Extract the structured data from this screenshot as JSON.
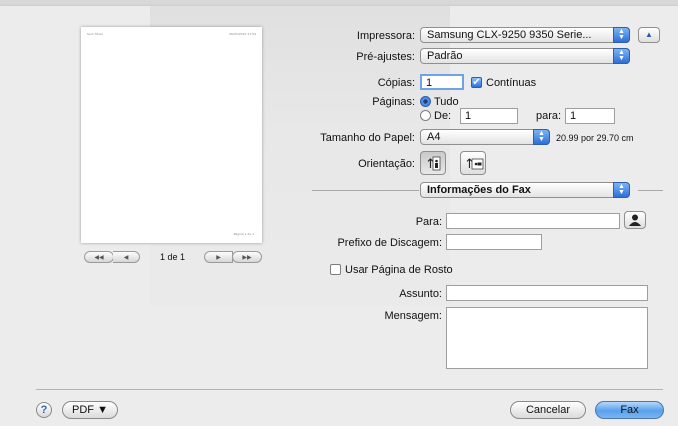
{
  "preview": {
    "header_left": "Sem Título",
    "header_right": "26/05/2010 17:54",
    "footer": "Página 1 de 1",
    "page_indicator": "1 de 1"
  },
  "printer": {
    "label": "Impressora:",
    "value": "Samsung CLX-9250 9350 Serie..."
  },
  "presets": {
    "label": "Pré-ajustes:",
    "value": "Padrão"
  },
  "copies": {
    "label": "Cópias:",
    "value": "1",
    "collated_label": "Contínuas",
    "collated": true
  },
  "pages": {
    "label": "Páginas:",
    "all_label": "Tudo",
    "from_label": "De:",
    "from_value": "1",
    "to_label": "para:",
    "to_value": "1"
  },
  "paper": {
    "label": "Tamanho do Papel:",
    "value": "A4",
    "dimensions": "20.99 por 29.70 cm"
  },
  "orientation": {
    "label": "Orientação:"
  },
  "section": {
    "value": "Informações do Fax"
  },
  "fax": {
    "to_label": "Para:",
    "to_value": "",
    "dial_prefix_label": "Prefixo de Discagem:",
    "dial_prefix_value": "",
    "cover_page_label": "Usar Página de Rosto",
    "subject_label": "Assunto:",
    "subject_value": "",
    "message_label": "Mensagem:",
    "message_value": ""
  },
  "footer": {
    "help_label": "?",
    "pdf_label": "PDF ▼",
    "cancel_label": "Cancelar",
    "fax_label": "Fax"
  },
  "colors": {
    "accent": "#3b7fe0",
    "sheet": "#ececec"
  }
}
